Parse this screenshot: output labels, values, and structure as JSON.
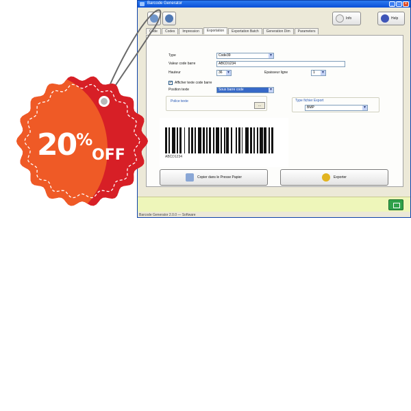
{
  "window": {
    "title": "Barcode Generator",
    "toolbar": {
      "info_label": "Info",
      "help_label": "Help"
    },
    "tabs": [
      "Code",
      "Codes",
      "Impression",
      "Exportation",
      "Exportation Batch",
      "Generation Dim",
      "Parameters"
    ],
    "active_tab": 3
  },
  "form": {
    "type_label": "Type",
    "type_value": "Code39",
    "value_label": "Valeur code barre",
    "value_value": "ABCD1234",
    "hauteur_label": "Hauteur",
    "hauteur_value": "36",
    "epaisseur_label": "Epaisseur ligne",
    "epaisseur_value": "1",
    "checkbox_label": "Afficher texte code barre",
    "position_label": "Position texte",
    "position_value": "Sous barre code",
    "police_label": "Police texte",
    "police_button": "...",
    "group_title": "Type fichier Export",
    "format_value": "BMP"
  },
  "barcode": {
    "text": "ABCD1234"
  },
  "actions": {
    "copy_label": "Copier dans le Presse Papier",
    "export_label": "Exporter"
  },
  "status": {
    "text": "Barcode Generator 2.0.0 — Software"
  },
  "promo": {
    "percent": "20",
    "percent_sign": "%",
    "off": "OFF"
  },
  "colors": {
    "tag_red": "#d71f26",
    "tag_orange": "#ef5a26",
    "tag_border": "#ffffff"
  }
}
